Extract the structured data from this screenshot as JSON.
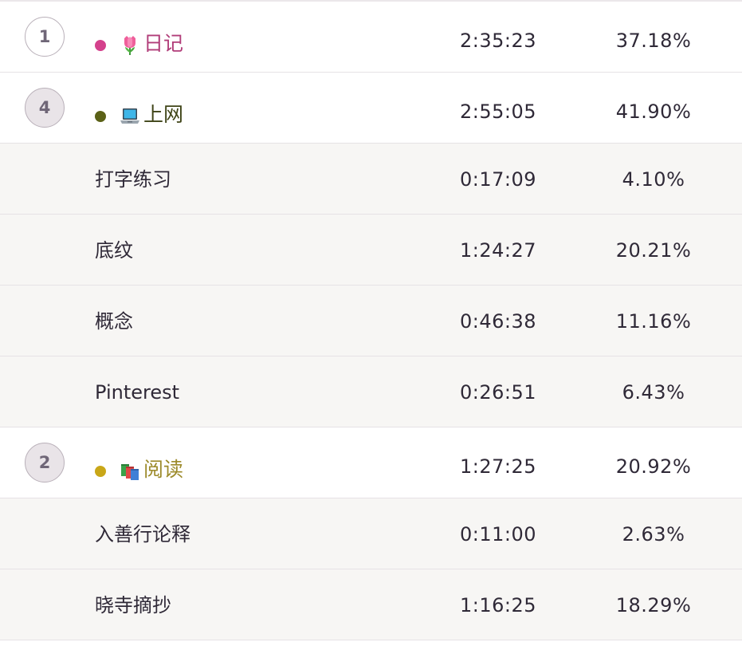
{
  "rows": [
    {
      "kind": "category",
      "rank": "1",
      "name": "日记",
      "time": "2:35:23",
      "percent": "37.18%",
      "dot_color": "#d4418c",
      "name_color": "#b13d79",
      "icon": "tulip-icon"
    },
    {
      "kind": "category",
      "rank": "4",
      "name": "上网",
      "time": "2:55:05",
      "percent": "41.90%",
      "dot_color": "#5b6117",
      "name_color": "#3f4417",
      "icon": "laptop-icon"
    },
    {
      "kind": "sub",
      "name": "打字练习",
      "time": "0:17:09",
      "percent": "4.10%"
    },
    {
      "kind": "sub",
      "name": "底纹",
      "time": "1:24:27",
      "percent": "20.21%"
    },
    {
      "kind": "sub",
      "name": "概念",
      "time": "0:46:38",
      "percent": "11.16%"
    },
    {
      "kind": "sub",
      "name": "Pinterest",
      "time": "0:26:51",
      "percent": "6.43%"
    },
    {
      "kind": "category",
      "rank": "2",
      "name": "阅读",
      "time": "1:27:25",
      "percent": "20.92%",
      "dot_color": "#c9a718",
      "name_color": "#9c8a2a",
      "icon": "books-icon"
    },
    {
      "kind": "sub",
      "name": "入善行论释",
      "time": "0:11:00",
      "percent": "2.63%"
    },
    {
      "kind": "sub",
      "name": "晓寺摘抄",
      "time": "1:16:25",
      "percent": "18.29%"
    }
  ]
}
